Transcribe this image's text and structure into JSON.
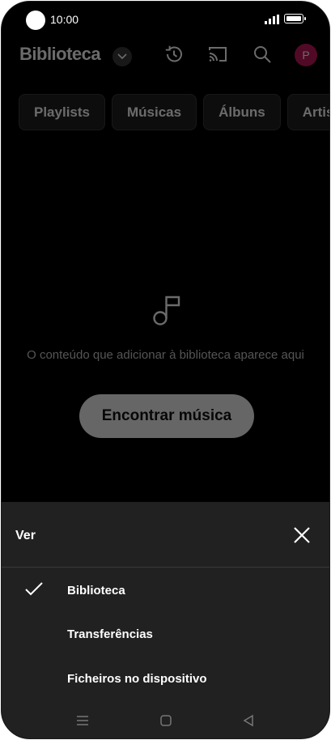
{
  "status_bar": {
    "time": "10:00"
  },
  "header": {
    "title": "Biblioteca",
    "avatar_letter": "P",
    "icons": [
      "history-icon",
      "cast-icon",
      "search-icon"
    ]
  },
  "chips": [
    "Playlists",
    "Músicas",
    "Álbuns",
    "Artis"
  ],
  "empty_state": {
    "message": "O conteúdo que adicionar à biblioteca aparece aqui",
    "button_label": "Encontrar música"
  },
  "sheet": {
    "title": "Ver",
    "options": [
      {
        "label": "Biblioteca",
        "selected": true
      },
      {
        "label": "Transferências",
        "selected": false
      },
      {
        "label": "Ficheiros no dispositivo",
        "selected": false
      }
    ]
  },
  "colors": {
    "background": "#000000",
    "sheet": "#212121",
    "avatar": "#c2185b",
    "text": "#ffffff"
  }
}
